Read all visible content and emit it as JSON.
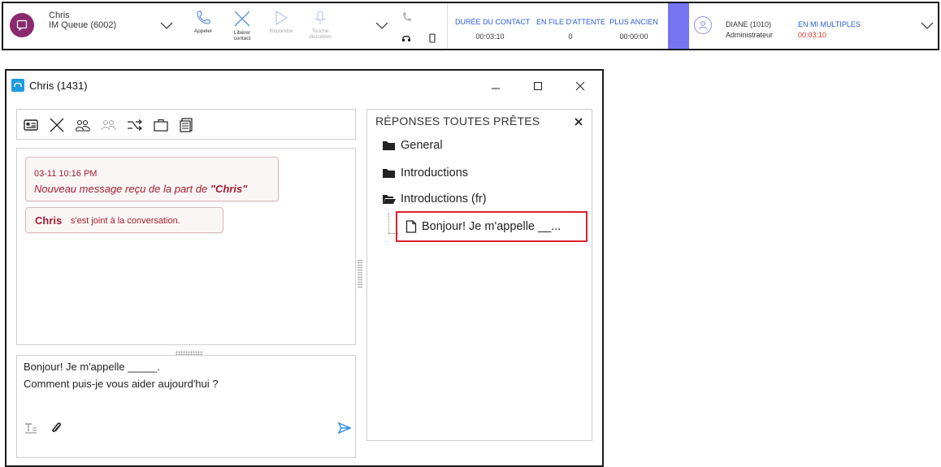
{
  "toolbar": {
    "contact_name": "Chris",
    "contact_queue": "IM Queue (6002)",
    "actions": [
      {
        "label_1": "Appeler",
        "label_2": ""
      },
      {
        "label_1": "Libérer",
        "label_2": "contact"
      },
      {
        "label_1": "Répondre",
        "label_2": ""
      },
      {
        "label_1": "Touche",
        "label_2": "discrétion"
      }
    ],
    "stats": [
      {
        "label": "DURÉE DU CONTACT",
        "value": "00:03:10"
      },
      {
        "label": "EN FILE D'ATTENTE",
        "value": "0"
      },
      {
        "label": "PLUS ANCIEN",
        "value": "00:00:00"
      }
    ],
    "agent_name": "DIANE (1010)",
    "agent_role": "Administrateur",
    "agent_status": "EN MI MULTIPLES",
    "agent_timer": "00:03:10"
  },
  "window": {
    "title": "Chris (1431)"
  },
  "chat": {
    "messages": [
      {
        "time": "03-11 10:16 PM",
        "text_prefix": "Nouveau message reçu de la part de ",
        "sender": "\"Chris\""
      },
      {
        "name": "Chris",
        "text": "s'est joint à la conversation."
      }
    ],
    "compose_line_1": "Bonjour! Je m'appelle _____.",
    "compose_line_2": "Comment puis-je vous aider aujourd'hui ?"
  },
  "canned": {
    "title": "RÉPONSES TOUTES PRÊTES",
    "items": [
      {
        "label": "General",
        "icon": "folder-icon"
      },
      {
        "label": "Introductions",
        "icon": "folder-icon"
      },
      {
        "label": "Introductions (fr)",
        "icon": "folder-open-icon"
      },
      {
        "label": "Bonjour! Je m'appelle __...",
        "icon": "document-icon"
      }
    ]
  },
  "colors": {
    "accent_blue": "#2b5bd8",
    "timer_red": "#e0312b",
    "message_red": "#a11b32",
    "highlight_red": "#d9232e",
    "agent_purple": "#7676f2",
    "contact_avatar": "#8a2a6f"
  }
}
